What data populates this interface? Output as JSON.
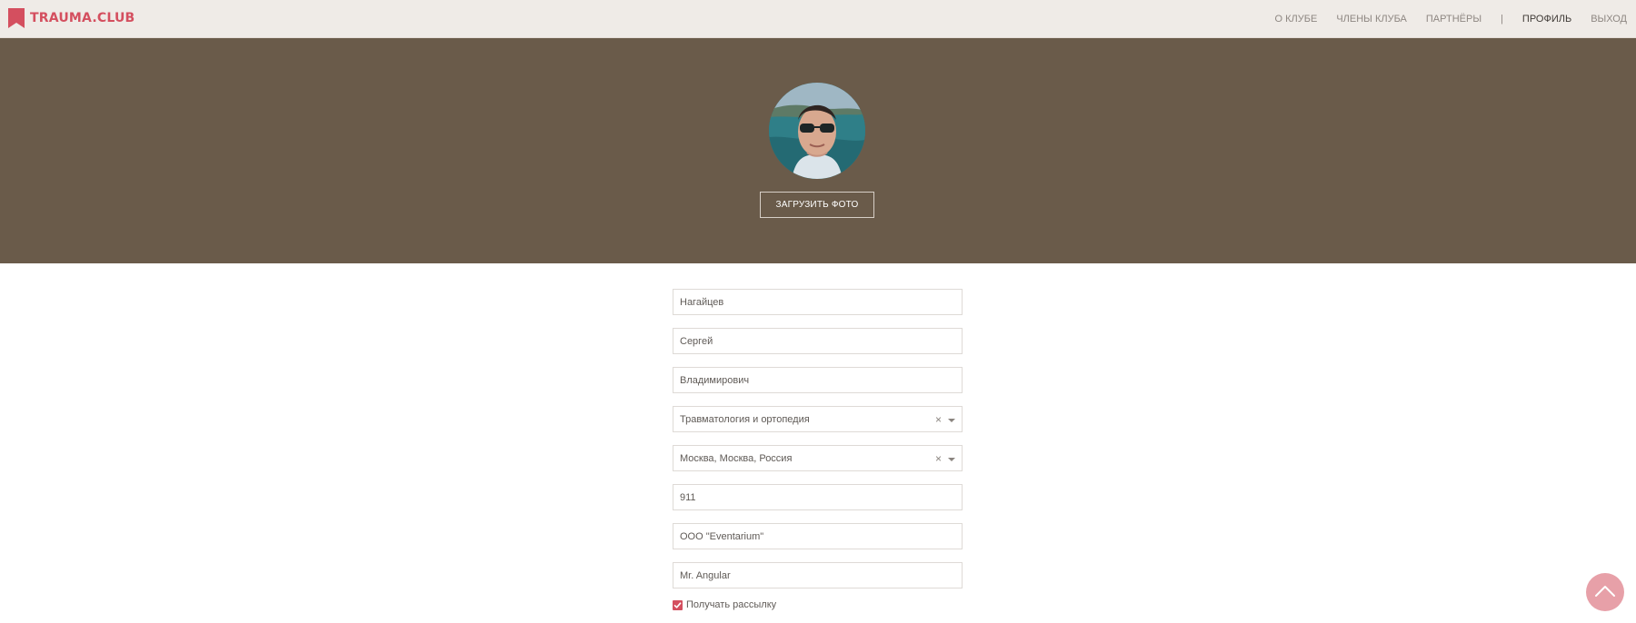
{
  "app": {
    "logo_text": "TRAUMA.CLUB",
    "brand_color": "#d44f5f",
    "hero_color": "#6a5b4a"
  },
  "nav": {
    "items": [
      {
        "label": "О клубе",
        "active": false
      },
      {
        "label": "Члены клуба",
        "active": false
      },
      {
        "label": "Партнёры",
        "active": false
      }
    ],
    "divider": "|",
    "profile_label": "Профиль",
    "logout_label": "Выход"
  },
  "hero": {
    "upload_button_label": "Загрузить фото",
    "avatar_icon": "user-photo"
  },
  "form": {
    "fields": {
      "last_name": "Нагайцев",
      "first_name": "Сергей",
      "middle_name": "Владимирович",
      "specialty": "Травматология и ортопедия",
      "city": "Москва, Москва, Россия",
      "phone": "911",
      "company": "ООО \"Eventarium\"",
      "position": "Mr. Angular"
    },
    "newsletter": {
      "label": "Получать рассылку",
      "checked": true
    }
  },
  "icons": {
    "clear": "×",
    "scroll_top": "chevron-up-icon"
  }
}
